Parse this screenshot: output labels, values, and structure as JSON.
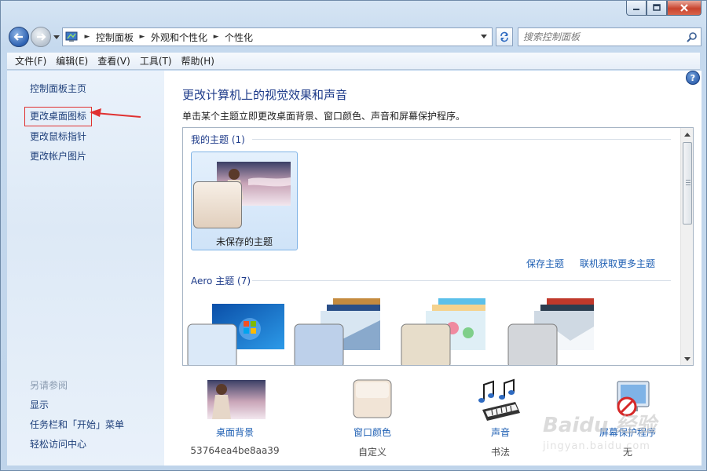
{
  "window": {
    "caption_buttons": [
      "minimize-icon",
      "maximize-icon",
      "close-icon"
    ]
  },
  "navigation": {
    "breadcrumb": [
      "控制面板",
      "外观和个性化",
      "个性化"
    ],
    "search_placeholder": "搜索控制面板"
  },
  "menu": [
    "文件(F)",
    "编辑(E)",
    "查看(V)",
    "工具(T)",
    "帮助(H)"
  ],
  "sidebar": {
    "home": "控制面板主页",
    "tasks": [
      "更改桌面图标",
      "更改鼠标指针",
      "更改帐户图片"
    ],
    "see_also_heading": "另请参阅",
    "see_also": [
      "显示",
      "任务栏和「开始」菜单",
      "轻松访问中心"
    ]
  },
  "main": {
    "title": "更改计算机上的视觉效果和声音",
    "description": "单击某个主题立即更改桌面背景、窗口颜色、声音和屏幕保护程序。",
    "my_themes": {
      "heading": "我的主题 (1)",
      "items": [
        {
          "label": "未保存的主题"
        }
      ],
      "save_link": "保存主题",
      "online_link": "联机获取更多主题"
    },
    "aero_themes": {
      "heading": "Aero 主题 (7)"
    }
  },
  "bottom": [
    {
      "label": "桌面背景",
      "sub": "53764ea4be8aa39"
    },
    {
      "label": "窗口颜色",
      "sub": "自定义"
    },
    {
      "label": "声音",
      "sub": "书法"
    },
    {
      "label": "屏幕保护程序",
      "sub": "无"
    }
  ],
  "watermark": {
    "brand": "Baidu 经验",
    "url": "jingyan.baidu.com"
  },
  "colors": {
    "link": "#1e5fb3",
    "title": "#1e3b8a",
    "highlight": "#e03131",
    "selection": "#cfe3f8"
  }
}
